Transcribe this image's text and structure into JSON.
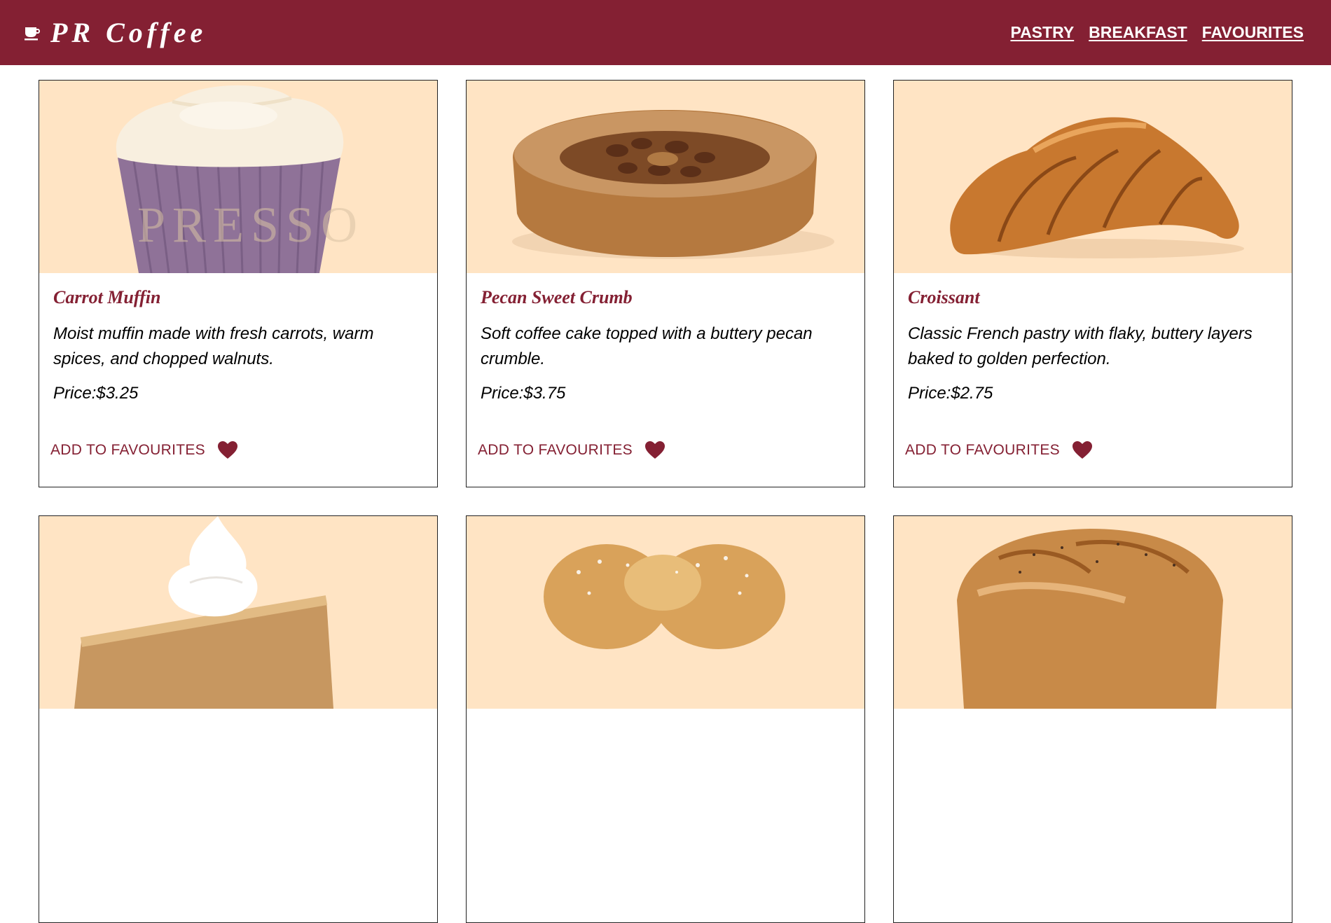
{
  "navbar": {
    "brand": "PR Coffee",
    "brand_icon": "coffee-cup-icon",
    "links": [
      "PASTRY",
      "BREAKFAST",
      "FAVOURITES"
    ],
    "background": "#842033"
  },
  "products": [
    {
      "name": "Carrot Muffin",
      "description": "Moist muffin made with fresh carrots, warm spices, and chopped walnuts.",
      "price": "Price:$3.25",
      "fav_label": "ADD TO FAVOURITES"
    },
    {
      "name": "Pecan Sweet Crumb",
      "description": "Soft coffee cake topped with a buttery pecan crumble.",
      "price": "Price:$3.75",
      "fav_label": "ADD TO FAVOURITES"
    },
    {
      "name": "Croissant",
      "description": "Classic French pastry with flaky, buttery layers baked to golden perfection.",
      "price": "Price:$2.75",
      "fav_label": "ADD TO FAVOURITES"
    },
    {
      "name": "",
      "description": "",
      "price": "",
      "fav_label": ""
    },
    {
      "name": "",
      "description": "",
      "price": "",
      "fav_label": ""
    },
    {
      "name": "",
      "description": "",
      "price": "",
      "fav_label": ""
    }
  ],
  "colors": {
    "accent": "#842033",
    "image_bg": "#ffe4c4"
  },
  "icons": {
    "favourite": "heart-icon"
  }
}
